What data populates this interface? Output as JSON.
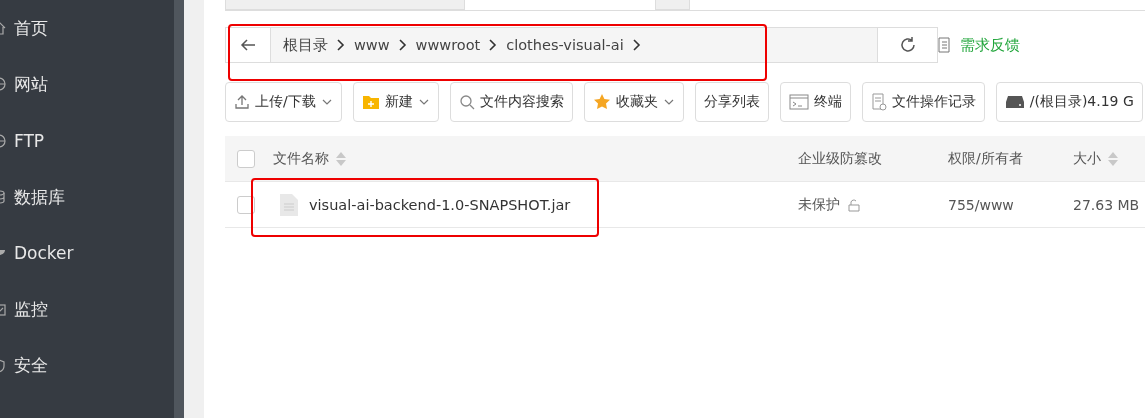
{
  "sidebar": {
    "items": [
      {
        "label": "首页",
        "kind": "home"
      },
      {
        "label": "网站",
        "kind": "globe"
      },
      {
        "label": "FTP",
        "kind": "globe"
      },
      {
        "label": "数据库",
        "kind": "database"
      },
      {
        "label": "Docker",
        "kind": "docker"
      },
      {
        "label": "监控",
        "kind": "monitor"
      },
      {
        "label": "安全",
        "kind": "shield"
      }
    ]
  },
  "breadcrumb": {
    "highlighted": true,
    "segments": [
      "根目录",
      "www",
      "wwwroot",
      "clothes-visual-ai"
    ]
  },
  "feedback": "需求反馈",
  "toolbar": [
    {
      "label": "上传/下载",
      "kind": "upload",
      "dropdown": true
    },
    {
      "label": "新建",
      "kind": "folder",
      "dropdown": true
    },
    {
      "label": "文件内容搜索",
      "kind": "search",
      "dropdown": false
    },
    {
      "label": "收藏夹",
      "kind": "star",
      "dropdown": true
    },
    {
      "label": "分享列表",
      "kind": "plain",
      "dropdown": false
    },
    {
      "label": "终端",
      "kind": "terminal",
      "dropdown": false
    },
    {
      "label": "文件操作记录",
      "kind": "log",
      "dropdown": false
    },
    {
      "label": "/(根目录)4.19 G",
      "kind": "disk",
      "dropdown": false
    }
  ],
  "table": {
    "header_checked": false,
    "columns": [
      {
        "label": "文件名称",
        "sortable": true
      },
      {
        "label": "企业级防篡改",
        "sortable": false
      },
      {
        "label": "权限/所有者",
        "sortable": false
      },
      {
        "label": "大小",
        "sortable": true
      }
    ],
    "rows": [
      {
        "name": "visual-ai-backend-1.0-SNAPSHOT.jar",
        "checked": false,
        "highlighted": true,
        "protection": "未保护",
        "permission": "755/www",
        "size": "27.63 MB"
      }
    ]
  }
}
